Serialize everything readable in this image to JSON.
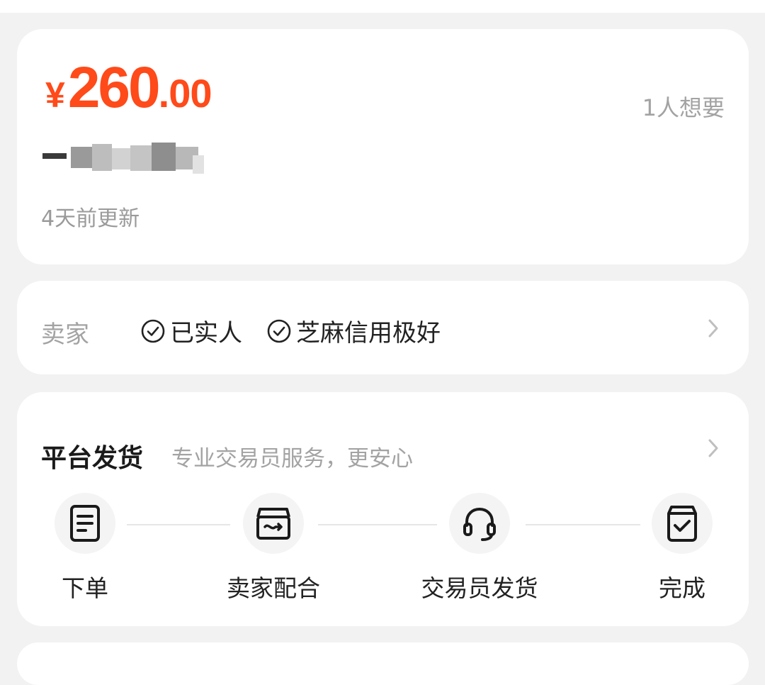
{
  "listing": {
    "price_currency": "¥",
    "price_integer": "260",
    "price_decimal": ".00",
    "wants": "1人想要",
    "updated": "4天前更新"
  },
  "seller": {
    "label": "卖家",
    "badges": [
      "已实人",
      "芝麻信用极好"
    ]
  },
  "shipping": {
    "title": "平台发货",
    "subtitle": "专业交易员服务，更安心",
    "steps": [
      "下单",
      "卖家配合",
      "交易员发货",
      "完成"
    ]
  },
  "colors": {
    "price": "#ff4a1a",
    "muted": "#a3a3a3",
    "background": "#f2f2f2",
    "card": "#ffffff"
  }
}
